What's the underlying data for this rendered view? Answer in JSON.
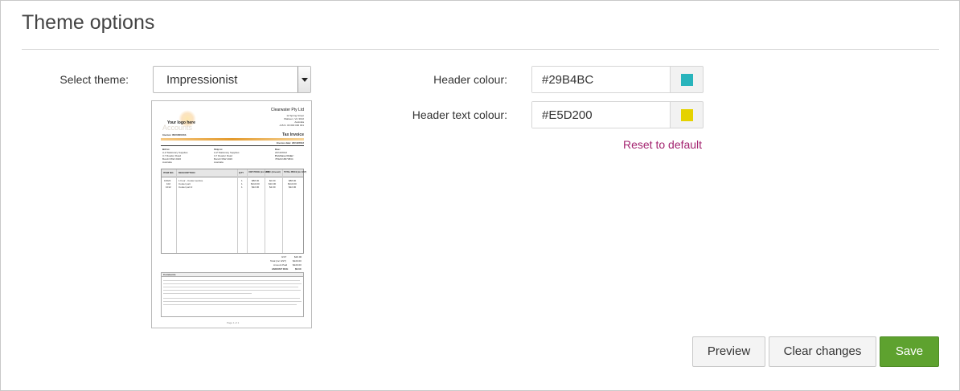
{
  "page": {
    "title": "Theme options"
  },
  "theme": {
    "label": "Select theme:",
    "selected": "Impressionist"
  },
  "preview_doc": {
    "logo_text": "Your logo here",
    "logo_word": "Accounts",
    "company": "Clearwater Pty Ltd",
    "address": [
      "12 Spring Street",
      "Waikeen, Vic 3192",
      "Australia",
      "A.B.N. 00 000 000 001"
    ],
    "doc_title": "Tax Invoice",
    "invoice_no": "Invoice: INV00001SS",
    "invoice_date": "Invoice date: 22/10/2012",
    "bill_to_label": "Bill to:",
    "bill_to": [
      "A-Z Stationary Supplies",
      "3-7 Reader Road",
      "Bondi NSW 2026",
      "Australia"
    ],
    "ship_to_label": "Ship to:",
    "ship_to": [
      "A-Z Stationary Supplies",
      "3-7 Reader Road",
      "Bondi NSW 2026",
      "Australia"
    ],
    "due_label": "Due:",
    "due": "22/10/2012",
    "po_label": "Purchase Order:",
    "po": "78324/18673834",
    "columns": [
      "ITEM NO.",
      "DESCRIPTION",
      "QTY",
      "UNIT PRICE (inc GST)",
      "DISC (Amount)",
      "TOTAL PRICE (inc GST)"
    ],
    "rows": [
      [
        "10023",
        "1 hour - Cooler service",
        "1",
        "$88.00",
        "$0.00",
        "$88.00"
      ],
      [
        "102",
        "Cooler part",
        "1",
        "$110.00",
        "$10.00",
        "$110.00"
      ],
      [
        "1012",
        "Cooler part 2",
        "1",
        "$22.00",
        "$2.00",
        "$22.00"
      ]
    ],
    "totals": [
      [
        "GST",
        "$20.00"
      ],
      [
        "Total (inc GST)",
        "$220.00"
      ],
      [
        "Amount Paid",
        "$220.00"
      ],
      [
        "AMOUNT DUE",
        "$0.00"
      ]
    ],
    "comments_label": "Comments",
    "page_label": "Page 1 of 1"
  },
  "header_colour": {
    "label": "Header colour:",
    "value": "#29B4BC",
    "swatch": "#29B4BC"
  },
  "header_text_colour": {
    "label": "Header text colour:",
    "value": "#E5D200",
    "swatch": "#E5D200"
  },
  "reset_label": "Reset to default",
  "buttons": {
    "preview": "Preview",
    "clear": "Clear changes",
    "save": "Save"
  }
}
